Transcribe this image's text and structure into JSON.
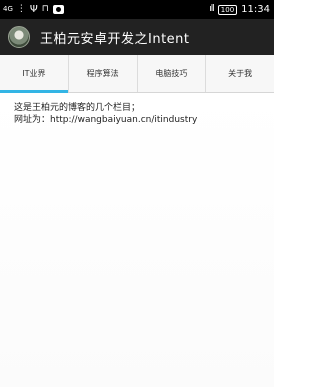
{
  "status_bar": {
    "network": "4G",
    "signal": "ıll",
    "battery": "100",
    "time": "11:34"
  },
  "action_bar": {
    "title": "王柏元安卓开发之Intent",
    "icon": "app-avatar-icon"
  },
  "tabs": [
    {
      "label": "IT业界",
      "active": true
    },
    {
      "label": "程序算法",
      "active": false
    },
    {
      "label": "电脑技巧",
      "active": false
    },
    {
      "label": "关于我",
      "active": false
    }
  ],
  "content": {
    "line1": "这是王柏元的博客的几个栏目；",
    "line2_prefix": "网址为：",
    "line2_url": "http://wangbaiyuan.cn/itindustry"
  },
  "colors": {
    "status_bar": "#000000",
    "action_bar": "#222222",
    "tab_indicator": "#33b5e5",
    "tab_background": "#f7f7f7"
  }
}
